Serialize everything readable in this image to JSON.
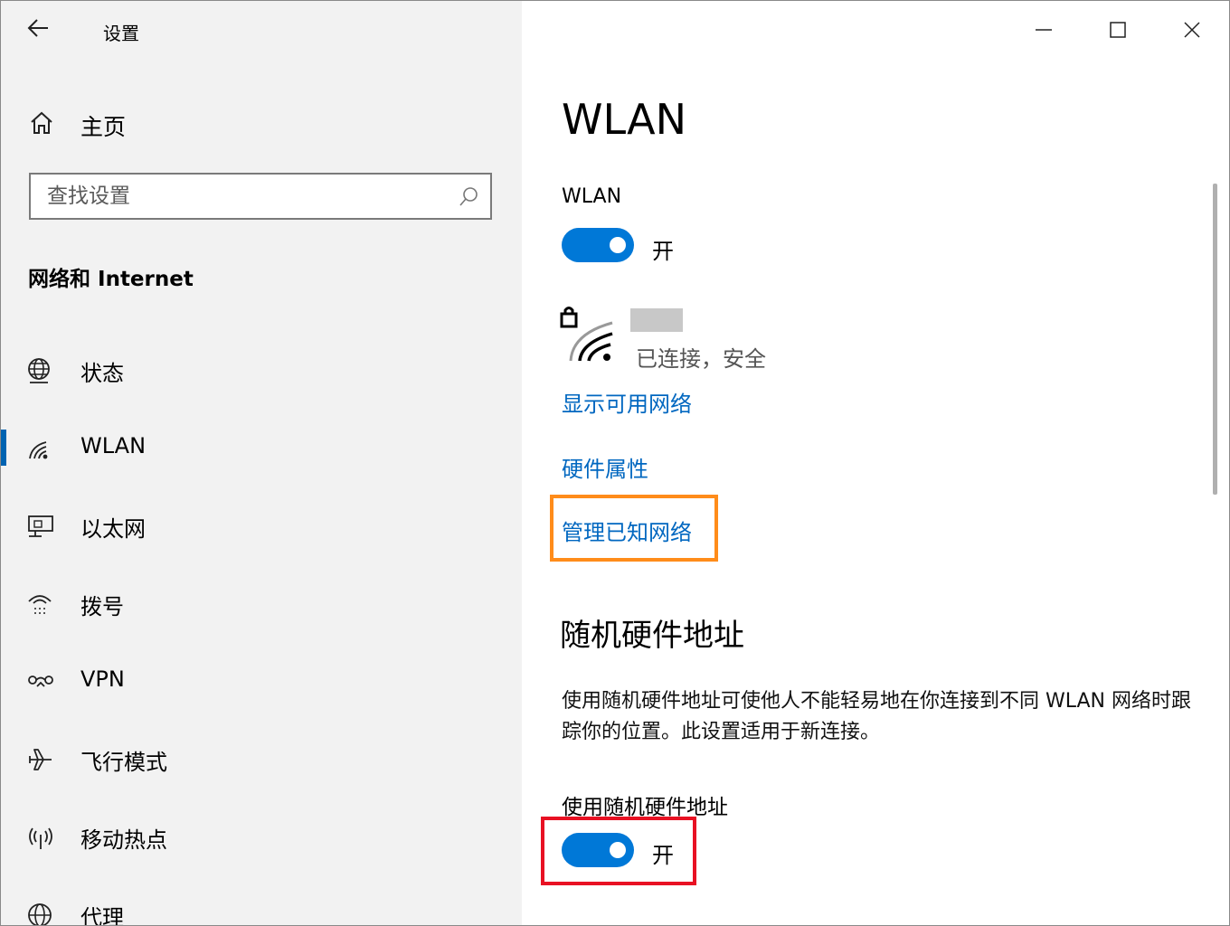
{
  "window": {
    "title": "设置"
  },
  "sidebar": {
    "home_label": "主页",
    "search_placeholder": "查找设置",
    "section_title": "网络和 Internet",
    "items": [
      {
        "label": "状态",
        "icon": "globe-icon"
      },
      {
        "label": "WLAN",
        "icon": "wifi-icon",
        "active": true
      },
      {
        "label": "以太网",
        "icon": "ethernet-icon"
      },
      {
        "label": "拨号",
        "icon": "dialup-icon"
      },
      {
        "label": "VPN",
        "icon": "vpn-icon"
      },
      {
        "label": "飞行模式",
        "icon": "airplane-icon"
      },
      {
        "label": "移动热点",
        "icon": "hotspot-icon"
      },
      {
        "label": "代理",
        "icon": "proxy-globe-icon"
      }
    ]
  },
  "main": {
    "page_title": "WLAN",
    "wlan_label": "WLAN",
    "wlan_toggle_state": "开",
    "network_status": "已连接，安全",
    "links": {
      "show_networks": "显示可用网络",
      "hardware_props": "硬件属性",
      "manage_known": "管理已知网络"
    },
    "random_mac": {
      "title": "随机硬件地址",
      "description": "使用随机硬件地址可使他人不能轻易地在你连接到不同 WLAN 网络时跟踪你的位置。此设置适用于新连接。",
      "toggle_label": "使用随机硬件地址",
      "toggle_state": "开"
    }
  },
  "colors": {
    "accent": "#0078d7",
    "link": "#0067c0",
    "highlight_orange": "#ff8c1a",
    "highlight_red": "#e81123"
  }
}
